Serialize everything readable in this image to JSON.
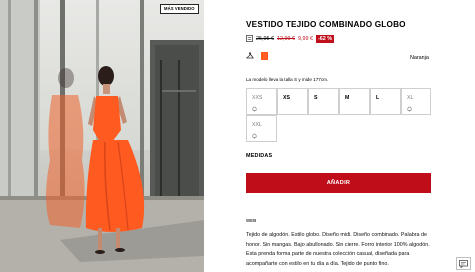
{
  "photo": {
    "badge": "MÁS VENDIDO",
    "alt": "Model wearing an orange midi knitted dress"
  },
  "product": {
    "title": "VESTIDO TEJIDO COMBINADO GLOBO",
    "prices": {
      "original": "25,95 €",
      "previous": "12,99 €",
      "current": "9,99 €",
      "discount": "-62 %"
    },
    "color": {
      "name": "Naranja",
      "swatch": "#ff5a1f"
    },
    "model_info": "La modelo lleva la talla S y mide 177cm.",
    "sizes": [
      {
        "label": "XXS",
        "available": false
      },
      {
        "label": "XS",
        "available": true
      },
      {
        "label": "S",
        "available": true
      },
      {
        "label": "M",
        "available": true
      },
      {
        "label": "L",
        "available": true
      },
      {
        "label": "XL",
        "available": false
      },
      {
        "label": "XXL",
        "available": false
      }
    ],
    "measurements_label": "MEDIDAS",
    "add_label": "AÑADIR",
    "section_tag": "WEB",
    "description": "Tejido de algodón. Estilo globo. Diseño midi. Diseño combinado. Palabra de honor. Sin mangas. Bajo abullonado. Sin cierre. Forro interior 100% algodón. Esta prenda forma parte de nuestra colección casual, diseñada para acompañarte con estilo en tu día a día. Tejido de punto fino."
  },
  "colors": {
    "accent_red": "#c00d1a",
    "price_red": "#c0101c",
    "dress_orange": "#ff5a1f"
  }
}
